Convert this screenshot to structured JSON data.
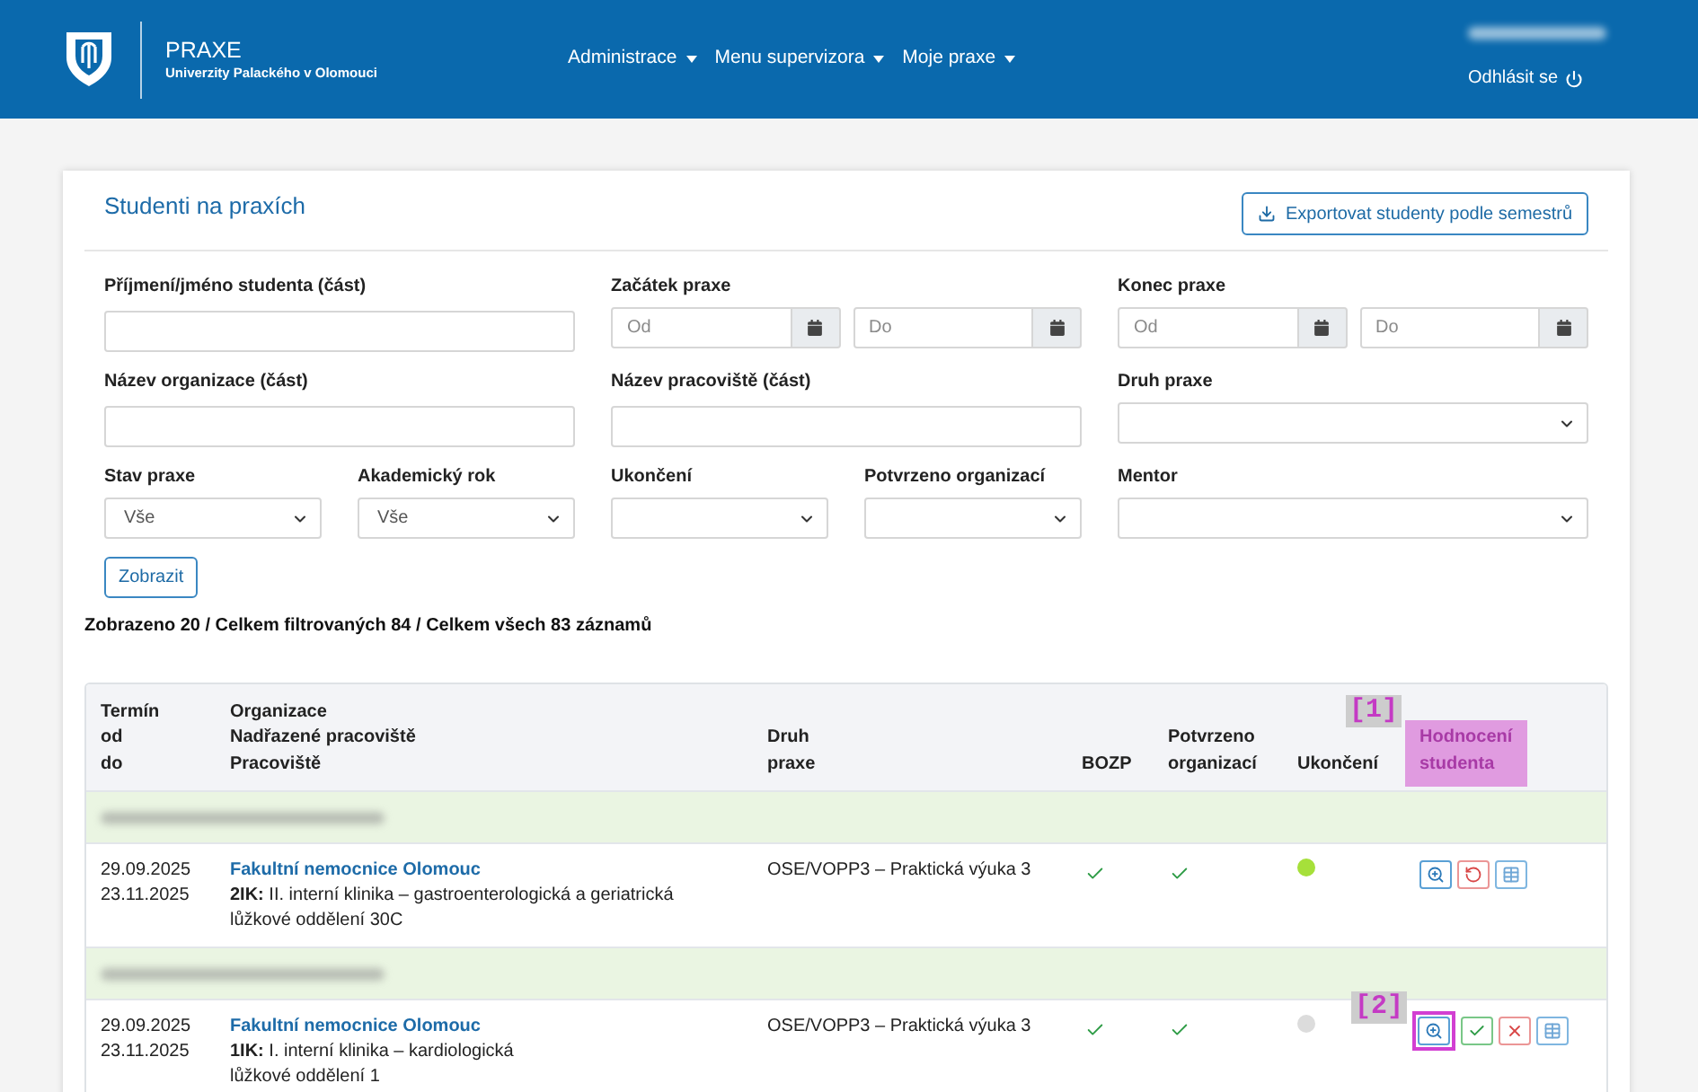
{
  "header": {
    "title": "PRAXE",
    "subtitle": "Univerzity Palackého v Olomouci",
    "nav": [
      {
        "label": "Administrace"
      },
      {
        "label": "Menu supervizora"
      },
      {
        "label": "Moje praxe"
      }
    ],
    "logout": "Odhlásit se"
  },
  "panel": {
    "title": "Studenti na praxích",
    "export_button": "Exportovat studenty podle semestrů"
  },
  "filter_rows": [
    [
      {
        "kind": "text",
        "label": "Příjmení/jméno studenta (část)"
      },
      {
        "kind": "date_range",
        "label": "Začátek praxe",
        "placeholders": [
          "Od",
          "Do"
        ]
      },
      {
        "kind": "date_range",
        "label": "Konec praxe",
        "placeholders": [
          "Od",
          "Do"
        ]
      }
    ],
    [
      {
        "kind": "text",
        "label": "Název organizace (část)"
      },
      {
        "kind": "text",
        "label": "Název pracoviště (část)"
      },
      {
        "kind": "select",
        "label": "Druh praxe"
      }
    ],
    [
      {
        "kind": "select",
        "label": "Stav praxe",
        "value": "Vše"
      },
      {
        "kind": "select",
        "label": "Akademický rok",
        "value": "Vše"
      },
      {
        "kind": "select",
        "label": "Ukončení"
      },
      {
        "kind": "select",
        "label": "Potvrzeno organizací"
      },
      {
        "kind": "select",
        "label": "Mentor"
      }
    ]
  ],
  "submit_button": "Zobrazit",
  "summary": "Zobrazeno 20 / Celkem filtrovaných 84 / Celkem všech 83 záznamů",
  "table": {
    "columns": [
      {
        "lines": [
          "Termín",
          "od",
          "do"
        ],
        "highlighted": false
      },
      {
        "lines": [
          "Organizace",
          "Nadřazené pracoviště",
          "Pracoviště"
        ],
        "highlighted": false
      },
      {
        "lines": [
          "Druh",
          "praxe"
        ],
        "highlighted": false
      },
      {
        "lines": [
          "BOZP"
        ],
        "highlighted": false
      },
      {
        "lines": [
          "Potvrzeno",
          "organizací"
        ],
        "highlighted": false
      },
      {
        "lines": [
          "Ukončení"
        ],
        "highlighted": false
      },
      {
        "lines": [
          "Hodnocení",
          "studenta"
        ],
        "highlighted": true,
        "annotation": "[1]"
      }
    ],
    "groups": [
      {
        "rows": [
          {
            "from": "29.09.2025",
            "to": "23.11.2025",
            "organization": "Fakultní nemocnice Olomouc",
            "parent_workplace": "**2IK:** II. interní klinika – gastroenterologická a geriatrická",
            "workplace": "lůžkové oddělení 30C",
            "practice_type": "OSE/VOPP3 – Praktická výuka 3",
            "bozp": true,
            "confirmed": true,
            "completion": {
              "color": "#a6e03a"
            },
            "actions": [
              {
                "kind": "detail",
                "highlighted": false
              },
              {
                "kind": "revert",
                "highlighted": false
              },
              {
                "kind": "table",
                "highlighted": false
              }
            ]
          }
        ]
      },
      {
        "rows": [
          {
            "from": "29.09.2025",
            "to": "23.11.2025",
            "organization": "Fakultní nemocnice Olomouc",
            "parent_workplace": "**1IK:** I. interní klinika – kardiologická",
            "workplace": "lůžkové oddělení 1",
            "practice_type": "OSE/VOPP3 – Praktická výuka 3",
            "bozp": true,
            "confirmed": true,
            "completion": {
              "color": "#dcdcdc"
            },
            "actions": [
              {
                "kind": "detail",
                "highlighted": true,
                "annotation": "[2]"
              },
              {
                "kind": "approve",
                "highlighted": false
              },
              {
                "kind": "reject",
                "highlighted": false
              },
              {
                "kind": "table",
                "highlighted": false
              }
            ]
          }
        ]
      }
    ]
  }
}
